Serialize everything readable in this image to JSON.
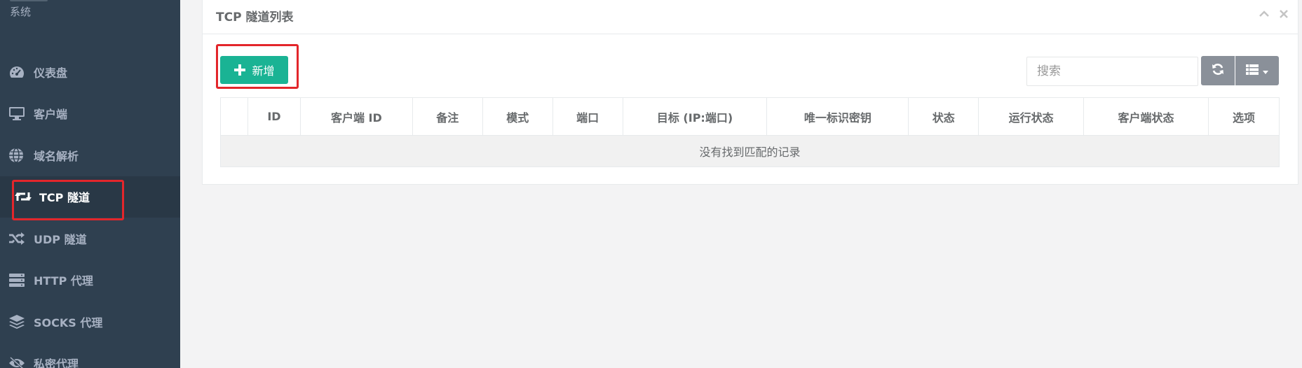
{
  "sidebar": {
    "brand_sub": "系统",
    "items": [
      {
        "label": "仪表盘",
        "icon": "dashboard-icon"
      },
      {
        "label": "客户端",
        "icon": "desktop-icon"
      },
      {
        "label": "域名解析",
        "icon": "globe-icon"
      },
      {
        "label": "TCP 隧道",
        "icon": "retweet-icon",
        "active": true
      },
      {
        "label": "UDP 隧道",
        "icon": "random-icon"
      },
      {
        "label": "HTTP 代理",
        "icon": "server-icon"
      },
      {
        "label": "SOCKS 代理",
        "icon": "layers-icon"
      },
      {
        "label": "私密代理",
        "icon": "eye-slash-icon"
      }
    ]
  },
  "panel": {
    "title": "TCP 隧道列表",
    "add_label": "新增",
    "search_placeholder": "搜索",
    "columns": [
      "",
      "ID",
      "客户端 ID",
      "备注",
      "模式",
      "端口",
      "目标 (IP:端口)",
      "唯一标识密钥",
      "状态",
      "运行状态",
      "客户端状态",
      "选项"
    ],
    "empty_text": "没有找到匹配的记录"
  },
  "colors": {
    "sidebar_bg": "#2f4050",
    "primary": "#1ab394",
    "highlight": "#e3262b"
  }
}
